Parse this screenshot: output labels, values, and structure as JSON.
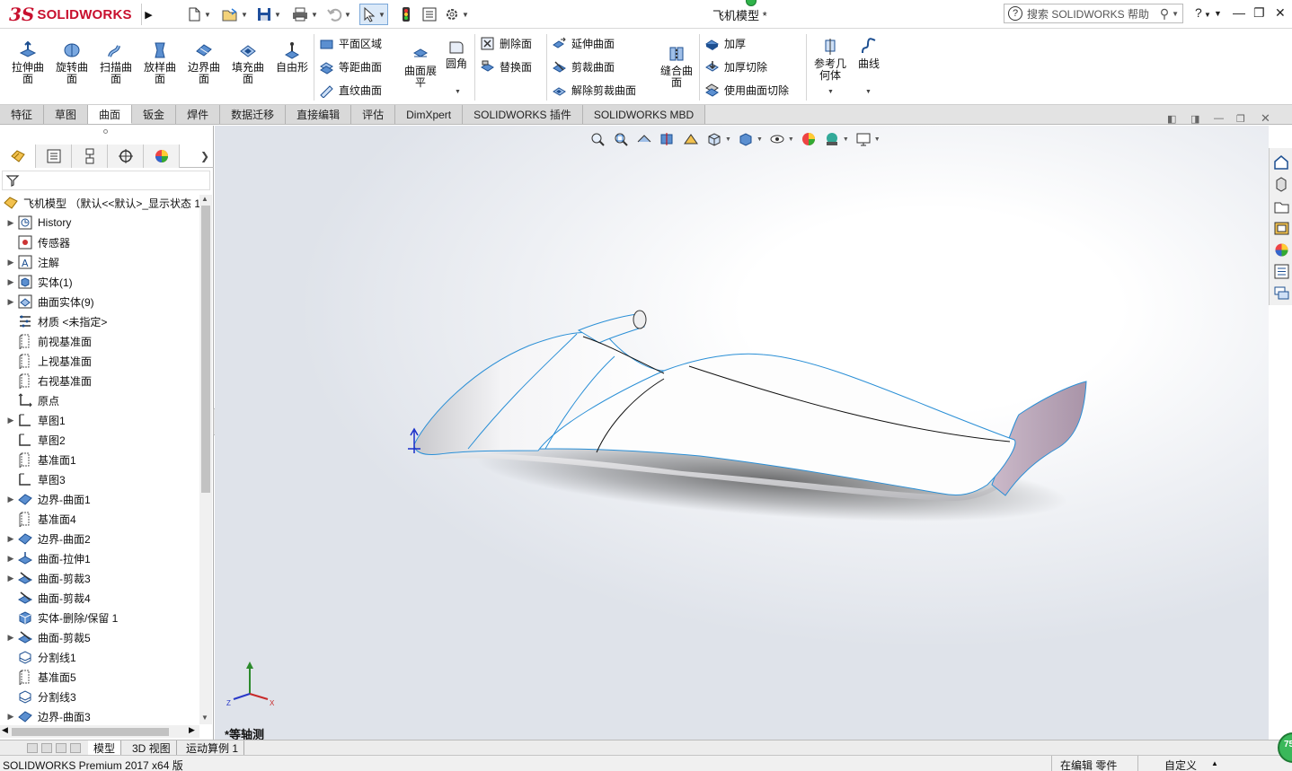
{
  "app": {
    "logo_ds": "3S",
    "logo_text": "SOLIDWORKS",
    "document_title": "飞机模型 *",
    "search_placeholder": "搜索 SOLIDWORKS 帮助",
    "help_label": "?"
  },
  "ribbon": {
    "big_tools": [
      {
        "label": "拉伸曲面",
        "icon": "extrude-surface-icon"
      },
      {
        "label": "旋转曲面",
        "icon": "revolve-surface-icon"
      },
      {
        "label": "扫描曲面",
        "icon": "sweep-surface-icon"
      },
      {
        "label": "放样曲面",
        "icon": "loft-surface-icon"
      },
      {
        "label": "边界曲面",
        "icon": "boundary-surface-icon"
      },
      {
        "label": "填充曲面",
        "icon": "fill-surface-icon"
      },
      {
        "label": "自由形",
        "icon": "freeform-icon"
      }
    ],
    "group2": [
      {
        "label": "平面区域",
        "icon": "planar-surface-icon"
      },
      {
        "label": "等距曲面",
        "icon": "offset-surface-icon"
      },
      {
        "label": "直纹曲面",
        "icon": "ruled-surface-icon"
      }
    ],
    "flatten": "曲面展平",
    "fillet": "圆角",
    "group3": [
      {
        "label": "删除面",
        "icon": "delete-face-icon"
      },
      {
        "label": "替换面",
        "icon": "replace-face-icon"
      }
    ],
    "group4": [
      {
        "label": "延伸曲面",
        "icon": "extend-surface-icon"
      },
      {
        "label": "剪裁曲面",
        "icon": "trim-surface-icon"
      },
      {
        "label": "解除剪裁曲面",
        "icon": "untrim-surface-icon"
      }
    ],
    "knit": "缝合曲面",
    "group5": [
      {
        "label": "加厚",
        "icon": "thicken-icon"
      },
      {
        "label": "加厚切除",
        "icon": "thicken-cut-icon"
      },
      {
        "label": "使用曲面切除",
        "icon": "surface-cut-icon"
      }
    ],
    "ref_geometry": "参考几何体",
    "curves": "曲线"
  },
  "tabs": [
    "特征",
    "草图",
    "曲面",
    "钣金",
    "焊件",
    "数据迁移",
    "直接编辑",
    "评估",
    "DimXpert",
    "SOLIDWORKS 插件",
    "SOLIDWORKS MBD"
  ],
  "active_tab": "曲面",
  "tree": {
    "root": "飞机模型 （默认<<默认>_显示状态 1",
    "items": [
      {
        "label": "History",
        "expand": true,
        "icon": "history-icon"
      },
      {
        "label": "传感器",
        "expand": false,
        "icon": "sensor-icon"
      },
      {
        "label": "注解",
        "expand": true,
        "icon": "annotation-icon"
      },
      {
        "label": "实体(1)",
        "expand": true,
        "icon": "solid-bodies-icon"
      },
      {
        "label": "曲面实体(9)",
        "expand": true,
        "icon": "surface-bodies-icon"
      },
      {
        "label": "材质 <未指定>",
        "expand": false,
        "icon": "material-icon"
      },
      {
        "label": "前视基准面",
        "expand": false,
        "icon": "plane-icon"
      },
      {
        "label": "上视基准面",
        "expand": false,
        "icon": "plane-icon"
      },
      {
        "label": "右视基准面",
        "expand": false,
        "icon": "plane-icon"
      },
      {
        "label": "原点",
        "expand": false,
        "icon": "origin-icon"
      },
      {
        "label": "草图1",
        "expand": true,
        "icon": "sketch-icon"
      },
      {
        "label": "草图2",
        "expand": false,
        "icon": "sketch-icon"
      },
      {
        "label": "基准面1",
        "expand": false,
        "icon": "plane-icon"
      },
      {
        "label": "草图3",
        "expand": false,
        "icon": "sketch-icon"
      },
      {
        "label": "边界-曲面1",
        "expand": true,
        "icon": "boundary-surface-icon"
      },
      {
        "label": "基准面4",
        "expand": false,
        "icon": "plane-icon"
      },
      {
        "label": "边界-曲面2",
        "expand": true,
        "icon": "boundary-surface-icon"
      },
      {
        "label": "曲面-拉伸1",
        "expand": true,
        "icon": "extrude-surface-icon"
      },
      {
        "label": "曲面-剪裁3",
        "expand": true,
        "icon": "trim-surface-icon"
      },
      {
        "label": "曲面-剪裁4",
        "expand": false,
        "icon": "trim-surface-icon"
      },
      {
        "label": "实体-删除/保留 1",
        "expand": false,
        "icon": "delete-body-icon"
      },
      {
        "label": "曲面-剪裁5",
        "expand": true,
        "icon": "trim-surface-icon"
      },
      {
        "label": "分割线1",
        "expand": false,
        "icon": "split-line-icon"
      },
      {
        "label": "基准面5",
        "expand": false,
        "icon": "plane-icon"
      },
      {
        "label": "分割线3",
        "expand": false,
        "icon": "split-line-icon"
      },
      {
        "label": "边界-曲面3",
        "expand": true,
        "icon": "boundary-surface-icon"
      }
    ]
  },
  "viewport": {
    "view_label": "*等轴测",
    "triad_x": "X",
    "triad_y": "Y",
    "triad_z": "Z"
  },
  "bottom_tabs": [
    "模型",
    "3D 视图",
    "运动算例 1"
  ],
  "status": {
    "product": "SOLIDWORKS Premium 2017 x64 版",
    "editing": "在编辑 零件",
    "custom": "自定义",
    "fps": "75"
  },
  "colors": {
    "brand": "#c8102e",
    "edge_blue": "#2a8fd6"
  }
}
